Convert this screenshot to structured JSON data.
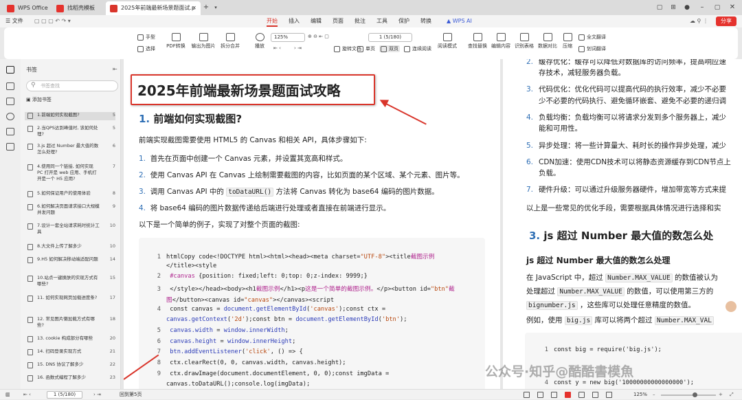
{
  "tabs": [
    {
      "label": "WPS Office"
    },
    {
      "label": "找稻壳模板"
    },
    {
      "label": "2025年前端最新场景题面试.p"
    }
  ],
  "menubar": {
    "file": "文件",
    "items": [
      "开始",
      "插入",
      "编辑",
      "页面",
      "批注",
      "工具",
      "保护",
      "转换"
    ],
    "ai": "WPS AI",
    "share": "分享"
  },
  "toolbar": {
    "hand": "手型",
    "select": "选择",
    "pdf_convert": "PDF转换",
    "export_image": "输出为图片",
    "split_merge": "拆分合并",
    "play": "播放",
    "zoom": "125%",
    "page": "1 (5/180)",
    "rotate": "旋转文档",
    "single": "单页",
    "double": "双页",
    "continuous": "连续阅读",
    "read_mode": "阅读模式",
    "find_replace": "查找替换",
    "edit_content": "编辑内容",
    "ocr_table": "识别表格",
    "compare": "数据对比",
    "compress": "压缩",
    "full_translate": "全文翻译",
    "word_translate": "划词翻译"
  },
  "bookmarks": {
    "title": "书签",
    "search_placeholder": "书签查找",
    "add": "添加书签",
    "items": [
      {
        "title": "1.前端如何实现截图?",
        "page": "5"
      },
      {
        "title": "2.当QPS达到峰值时, 该如何处理?",
        "page": "5"
      },
      {
        "title": "3.js 超过 Number 最大值的数怎么处理?",
        "page": "6"
      },
      {
        "title": "4.使用同一个链接, 如何实现 PC 打开是 web 应用、手机打开是一个 H5 应用?",
        "page": "7"
      },
      {
        "title": "5.如何保证用户的使用体验",
        "page": "8"
      },
      {
        "title": "6.如何解决页面请求接口大规模并发问题",
        "page": "9"
      },
      {
        "title": "7.设计一套全站请求耗时统计工具",
        "page": "10"
      },
      {
        "title": "8.大文件上传了解多少",
        "page": "10"
      },
      {
        "title": "9.H5 如何解决移动端适配问题",
        "page": "14"
      },
      {
        "title": "10.站点一键换肤的实现方式有哪些?",
        "page": "15"
      },
      {
        "title": "11. 如何实现网页加载进度条?",
        "page": "17"
      },
      {
        "title": "12. 常见图片懒加载方式有哪些?",
        "page": "18"
      },
      {
        "title": "13. cookie 构成部分有哪些",
        "page": "20"
      },
      {
        "title": "14. 扫码登录实现方式",
        "page": "21"
      },
      {
        "title": "15. DNS 协议了解多少",
        "page": "22"
      },
      {
        "title": "16. 函数式编程了解多少",
        "page": "23"
      }
    ]
  },
  "doc": {
    "title": "2025年前端最新场景题面试攻略",
    "h2_num": "1.",
    "h2_text": "前端如何实现截图?",
    "intro": "前端实现截图需要使用 HTML5 的 Canvas 和相关 API，具体步骤如下:",
    "steps": [
      {
        "num": "1.",
        "text": "首先在页面中创建一个 Canvas 元素，并设置其宽高和样式。"
      },
      {
        "num": "2.",
        "text": "使用 Canvas API 在 Canvas 上绘制需要截图的内容，比如页面的某个区域、某个元素、图片等。"
      },
      {
        "num": "3.",
        "pre": "调用 Canvas API 中的 ",
        "code": "toDataURL()",
        "post": " 方法将 Canvas 转化为 base64 编码的图片数据。"
      },
      {
        "num": "4.",
        "text": "将 base64 编码的图片数据传递给后端进行处理或者直接在前端进行显示。"
      }
    ],
    "example_intro": "以下是一个简单的例子，实现了对整个页面的截图:",
    "code": [
      {
        "n": "1",
        "parts": [
          [
            "",
            "htmlCopy code<!DOCTYPE html><html><head><meta charset="
          ],
          [
            "str",
            "\"UTF-8\""
          ],
          [
            "",
            "><title"
          ],
          [
            "tg",
            "截图示例"
          ]
        ]
      },
      {
        "n": "",
        "parts": [
          [
            "",
            "</title><style"
          ]
        ]
      },
      {
        "n": "2",
        "parts": [
          [
            "",
            "      "
          ],
          [
            "tg",
            "#canvas"
          ],
          [
            "",
            " {position: fixed;left: 0;top: 0;z-index: 9999;}"
          ]
        ]
      },
      {
        "n": "3",
        "parts": [
          [
            "",
            "    </style></head><body><h1"
          ],
          [
            "tg",
            "截图示例"
          ],
          [
            "",
            "</h1><p"
          ],
          [
            "tg",
            "这是一个简单的截图示例。"
          ],
          [
            "",
            "</p><button id="
          ],
          [
            "str",
            "\"btn\""
          ],
          [
            "tg",
            "截"
          ]
        ]
      },
      {
        "n": "",
        "parts": [
          [
            "tg",
            "图"
          ],
          [
            "",
            "</button><canvas id="
          ],
          [
            "str",
            "\"canvas\""
          ],
          [
            "",
            "></canvas><script"
          ]
        ]
      },
      {
        "n": "4",
        "parts": [
          [
            "",
            "      const canvas = "
          ],
          [
            "kw",
            "document.getElementById"
          ],
          [
            "",
            "("
          ],
          [
            "str",
            "'canvas'"
          ],
          [
            "",
            ");const ctx ="
          ]
        ]
      },
      {
        "n": "",
        "parts": [
          [
            "kw",
            "canvas.getContext"
          ],
          [
            "",
            "("
          ],
          [
            "str",
            "'2d'"
          ],
          [
            "",
            ");const btn = "
          ],
          [
            "kw",
            "document.getElementById"
          ],
          [
            "",
            "("
          ],
          [
            "str",
            "'btn'"
          ],
          [
            "",
            ");"
          ]
        ]
      },
      {
        "n": "5",
        "parts": [
          [
            "",
            "      "
          ],
          [
            "kw",
            "canvas.width"
          ],
          [
            "",
            " = "
          ],
          [
            "kw",
            "window.innerWidth"
          ],
          [
            "",
            ";"
          ]
        ]
      },
      {
        "n": "6",
        "parts": [
          [
            "",
            "      "
          ],
          [
            "kw",
            "canvas.height"
          ],
          [
            "",
            " = "
          ],
          [
            "kw",
            "window.innerHeight"
          ],
          [
            "",
            ";"
          ]
        ]
      },
      {
        "n": "7",
        "parts": [
          [
            "",
            "      "
          ],
          [
            "kw",
            "btn.addEventListener"
          ],
          [
            "",
            "("
          ],
          [
            "str",
            "'click'"
          ],
          [
            "",
            ", () => {"
          ]
        ]
      },
      {
        "n": "8",
        "parts": [
          [
            "",
            "        ctx.clearRect(0, 0, canvas.width, canvas.height);"
          ]
        ]
      },
      {
        "n": "9",
        "parts": [
          [
            "",
            "        ctx.drawImage(document.documentElement, 0, 0);const imgData ="
          ]
        ]
      },
      {
        "n": "",
        "parts": [
          [
            "",
            "canvas.toDataURL();console.log(imgData);"
          ]
        ]
      }
    ]
  },
  "page2": {
    "lines": [
      {
        "num": "2.",
        "text": "缓存优化：缓存可以降低对数据库的访问频率，提高响应速"
      },
      {
        "num": "",
        "text": "存技术，减轻服务器负载。"
      },
      {
        "num": "3.",
        "text": "代码优化：优化代码可以提高代码的执行效率，减少不必要"
      },
      {
        "num": "",
        "text": "少不必要的代码执行、避免循环嵌套、避免不必要的递归调"
      },
      {
        "num": "4.",
        "text": "负载均衡：负载均衡可以将请求分发到多个服务器上，减少"
      },
      {
        "num": "",
        "text": "能和可用性。"
      },
      {
        "num": "5.",
        "text": "异步处理：将一些计算量大、耗时长的操作异步处理，减少"
      },
      {
        "num": "6.",
        "text": "CDN加速：使用CDN技术可以将静态资源缓存到CDN节点上"
      },
      {
        "num": "",
        "text": "负载。"
      },
      {
        "num": "7.",
        "text": "硬件升级：可以通过升级服务器硬件，增加带宽等方式来提"
      }
    ],
    "summary": "以上是一些常见的优化手段，需要根据具体情况进行选择和实",
    "h2_num": "3.",
    "h2_text": "js 超过 Number 最大值的数怎么处",
    "h3": "js 超过 Number 最大值的数怎么处理",
    "para1_a": "在 JavaScript 中，超过 ",
    "para1_code": "Number.MAX_VALUE",
    "para1_b": " 的数值被认为",
    "para2_a": "处理超过 ",
    "para2_code": "Number.MAX_VALUE",
    "para2_b": " 的数值，可以使用第三方的",
    "para3_code": "bignumber.js",
    "para3_b": " ，这些库可以处理任意精度的数值。",
    "para4_a": "例如，使用 ",
    "para4_code": "big.js",
    "para4_b": " 库可以将两个超过 ",
    "para4_code2": "Number.MAX_VAL",
    "code1": "const big = require('big.js');",
    "code2": "const y = new big('10000000000000000');"
  },
  "watermark": "公众号·知乎@酷酷書模魚",
  "status": {
    "page_input": "1 (5/180)",
    "backup": "回到第5页",
    "zoom": "125%"
  }
}
